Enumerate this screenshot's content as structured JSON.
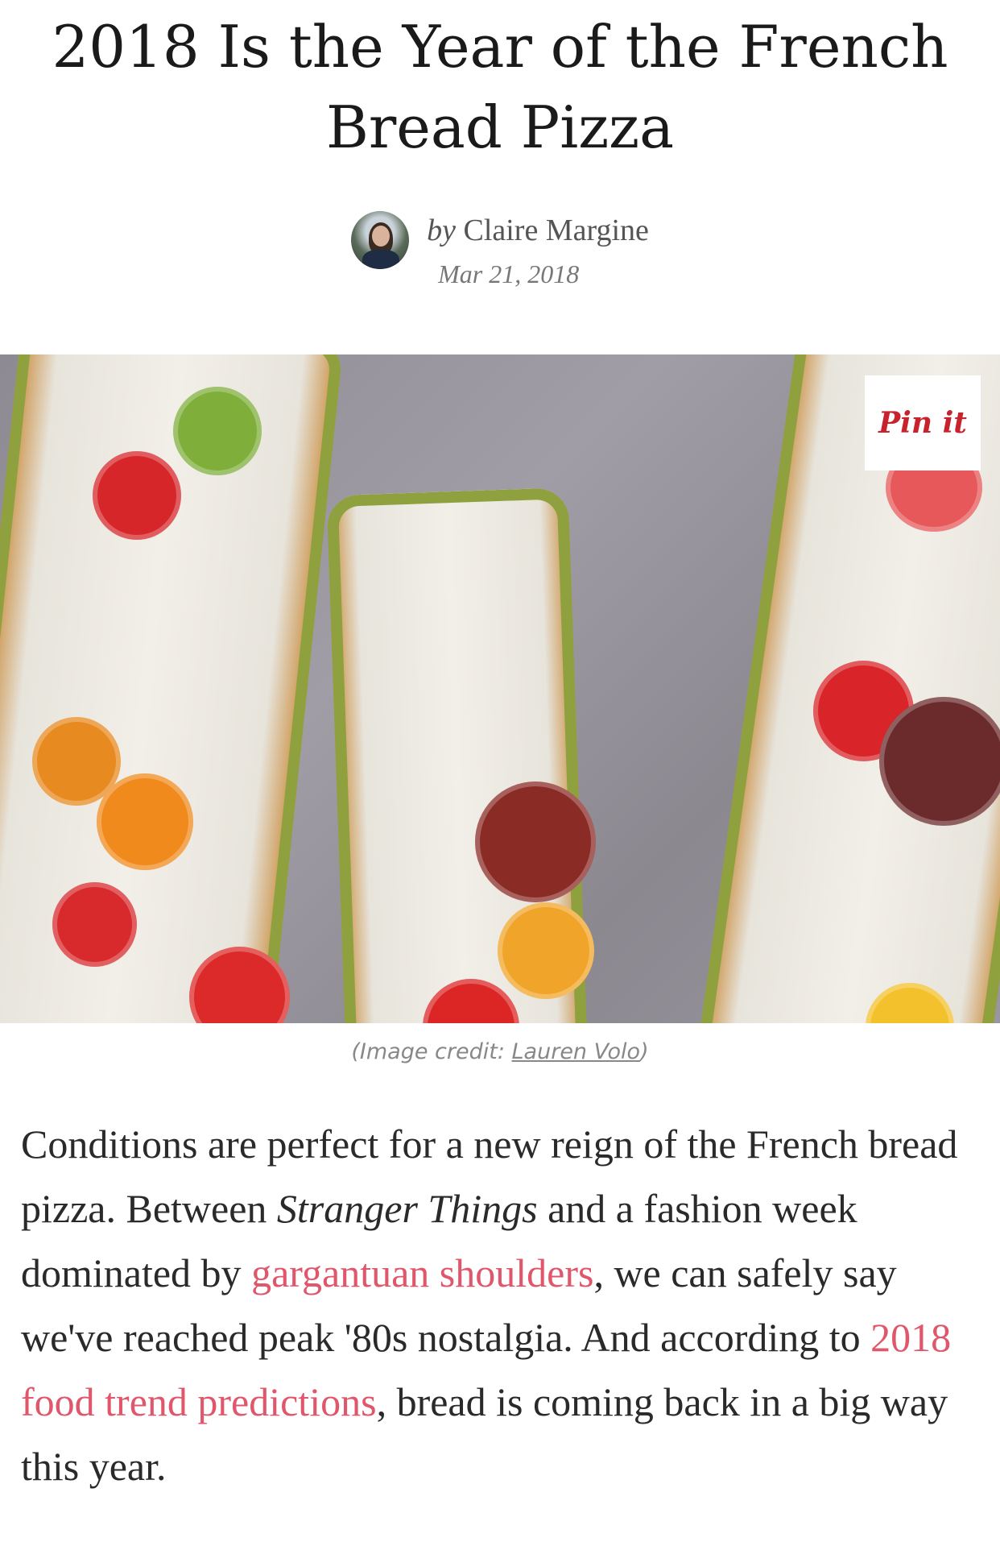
{
  "article": {
    "title": "2018 Is the Year of the French Bread Pizza",
    "author_prefix": "by",
    "author_name": "Claire Margine",
    "date": "Mar 21, 2018"
  },
  "hero_image": {
    "pin_label": "Pin it",
    "credit_prefix": "(Image credit: ",
    "credit_name": "Lauren Volo",
    "credit_suffix": ")"
  },
  "body": {
    "p1_a": "Conditions are perfect for a new reign of the French bread pizza. Between ",
    "p1_show": "Stranger Things",
    "p1_b": " and a fashion week dominated by ",
    "link_shoulders": "gargantuan shoulders",
    "p1_c": ", we can safely say we've reached peak '80s nostalgia. And according to ",
    "link_trends": "2018 food trend predictions",
    "p1_d": ", bread is coming back in a big way this year."
  },
  "colors": {
    "link": "#e0566a",
    "pin_red": "#c8232c"
  }
}
